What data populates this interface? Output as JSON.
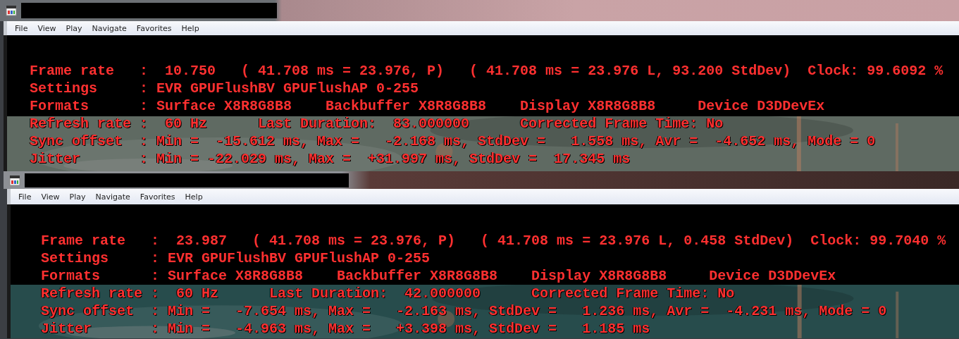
{
  "windows": [
    {
      "menu": [
        "File",
        "View",
        "Play",
        "Navigate",
        "Favorites",
        "Help"
      ],
      "osd_lines": [
        "Frame rate   :  10.750   ( 41.708 ms = 23.976, P)   ( 41.708 ms = 23.976 L, 93.200 StdDev)  Clock: 99.6092 %",
        "Settings     : EVR GPUFlushBV GPUFlushAP 0-255",
        "Formats      : Surface X8R8G8B8    Backbuffer X8R8G8B8    Display X8R8G8B8     Device D3DDevEx",
        "Refresh rate :  60 Hz      Last Duration:  83.000000      Corrected Frame Time: No",
        "Sync offset  : Min =  -15.612 ms, Max =   -2.168 ms, StdDev =   1.558 ms, Avr =  -4.652 ms, Mode = 0",
        "Jitter       : Min = -22.029 ms, Max =  +31.997 ms, StdDev =  17.345 ms"
      ]
    },
    {
      "menu": [
        "File",
        "View",
        "Play",
        "Navigate",
        "Favorites",
        "Help"
      ],
      "osd_lines": [
        "Frame rate   :  23.987   ( 41.708 ms = 23.976, P)   ( 41.708 ms = 23.976 L, 0.458 StdDev)  Clock: 99.7040 %",
        "Settings     : EVR GPUFlushBV GPUFlushAP 0-255",
        "Formats      : Surface X8R8G8B8    Backbuffer X8R8G8B8    Display X8R8G8B8     Device D3DDevEx",
        "Refresh rate :  60 Hz      Last Duration:  42.000000      Corrected Frame Time: No",
        "Sync offset  : Min =   -7.654 ms, Max =   -2.163 ms, StdDev =   1.236 ms, Avr =  -4.231 ms, Mode = 0",
        "Jitter       : Min =   -4.963 ms, Max =   +3.398 ms, StdDev =   1.185 ms"
      ]
    }
  ]
}
